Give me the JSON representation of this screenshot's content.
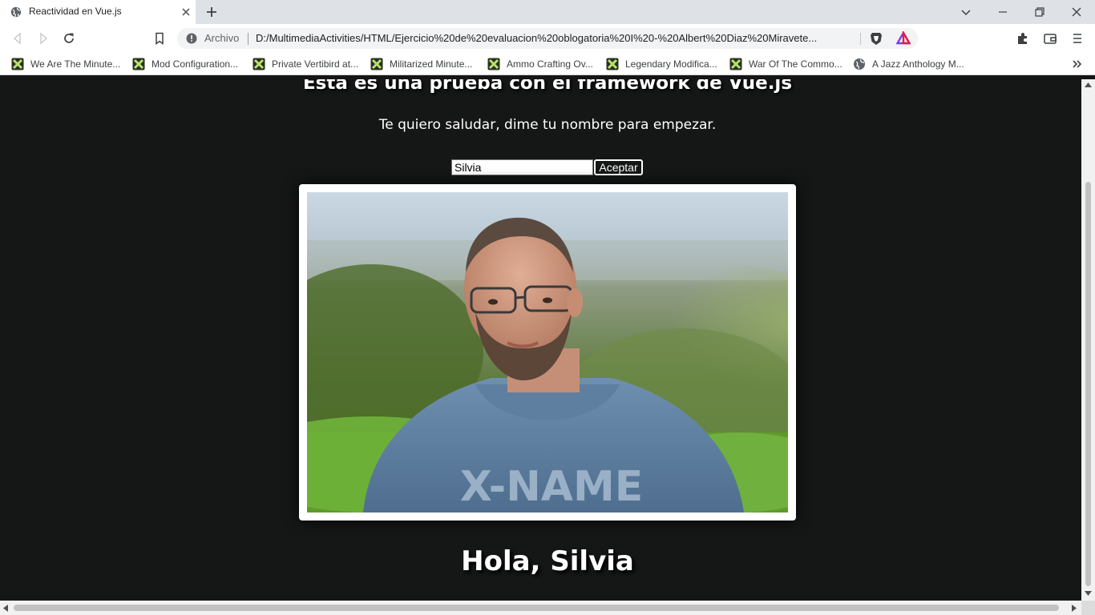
{
  "tab": {
    "title": "Reactividad en Vue.js"
  },
  "omnibox": {
    "security_label": "Archivo",
    "url": "D:/MultimediaActivities/HTML/Ejercicio%20de%20evaluacion%20oblogatoria%20I%20-%20Albert%20Diaz%20Miravete..."
  },
  "bookmarks": [
    {
      "label": "We Are The Minute...",
      "icon": "xcom-icon"
    },
    {
      "label": "Mod Configuration...",
      "icon": "xcom-icon"
    },
    {
      "label": "Private Vertibird at...",
      "icon": "xcom-icon"
    },
    {
      "label": "Militarized Minute...",
      "icon": "xcom-icon"
    },
    {
      "label": "Ammo Crafting Ov...",
      "icon": "xcom-icon"
    },
    {
      "label": "Legendary Modifica...",
      "icon": "xcom-icon"
    },
    {
      "label": "War Of The Commo...",
      "icon": "xcom-icon"
    },
    {
      "label": "A Jazz Anthology M...",
      "icon": "globe-icon"
    }
  ],
  "page": {
    "title": "Esta es una prueba con el framework de Vue.js",
    "prompt": "Te quiero saludar, dime tu nombre para empezar.",
    "name_value": "Silvia",
    "accept_label": "Aceptar",
    "greeting": "Hola, Silvia",
    "hoodie_text": "X-NAME"
  },
  "colors": {
    "page_bg": "#151616",
    "text": "#ffffff",
    "tabstrip_bg": "#dee1e6",
    "omnibox_bg": "#f1f3f4"
  }
}
